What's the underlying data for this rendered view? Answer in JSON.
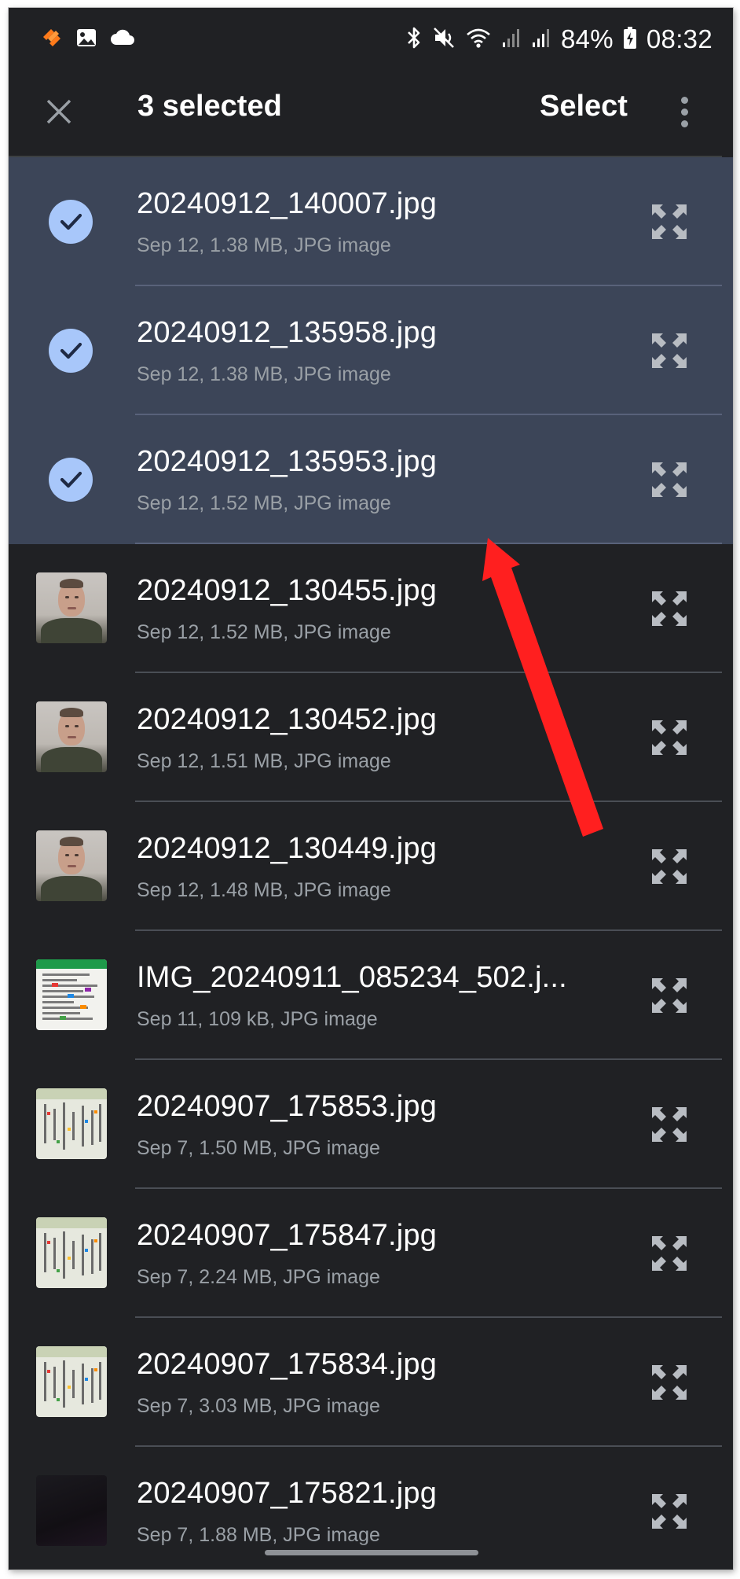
{
  "status_bar": {
    "battery": "84%",
    "time": "08:32",
    "left_icons": [
      "app-logo-icon",
      "gallery-icon",
      "cloud-icon"
    ],
    "right_icons": [
      "bluetooth-icon",
      "mute-icon",
      "wifi-icon",
      "signal-icon",
      "signal-icon",
      "battery-charging-icon"
    ]
  },
  "app_bar": {
    "title": "3 selected",
    "select_label": "Select",
    "close_icon": "close-icon",
    "more_icon": "more-vert-icon"
  },
  "colors": {
    "background": "#202124",
    "selected_row": "#3c4558",
    "check": "#a8c7fa",
    "meta_text": "#9aa0a6",
    "annotation_arrow": "#ff1f1f"
  },
  "files": [
    {
      "name": "20240912_140007.jpg",
      "meta": "Sep 12, 1.38 MB, JPG image",
      "selected": true,
      "thumb": "photo"
    },
    {
      "name": "20240912_135958.jpg",
      "meta": "Sep 12, 1.38 MB, JPG image",
      "selected": true,
      "thumb": "photo"
    },
    {
      "name": "20240912_135953.jpg",
      "meta": "Sep 12, 1.52 MB, JPG image",
      "selected": true,
      "thumb": "photo"
    },
    {
      "name": "20240912_130455.jpg",
      "meta": "Sep 12, 1.52 MB, JPG image",
      "selected": false,
      "thumb": "face"
    },
    {
      "name": "20240912_130452.jpg",
      "meta": "Sep 12, 1.51 MB, JPG image",
      "selected": false,
      "thumb": "face"
    },
    {
      "name": "20240912_130449.jpg",
      "meta": "Sep 12, 1.48 MB, JPG image",
      "selected": false,
      "thumb": "face"
    },
    {
      "name": "IMG_20240911_085234_502.j...",
      "meta": "Sep 11, 109 kB, JPG image",
      "selected": false,
      "thumb": "document"
    },
    {
      "name": "20240907_175853.jpg",
      "meta": "Sep 7, 1.50 MB, JPG image",
      "selected": false,
      "thumb": "sheet"
    },
    {
      "name": "20240907_175847.jpg",
      "meta": "Sep 7, 2.24 MB, JPG image",
      "selected": false,
      "thumb": "sheet"
    },
    {
      "name": "20240907_175834.jpg",
      "meta": "Sep 7, 3.03 MB, JPG image",
      "selected": false,
      "thumb": "sheet"
    },
    {
      "name": "20240907_175821.jpg",
      "meta": "Sep 7, 1.88 MB, JPG image",
      "selected": false,
      "thumb": "dark"
    }
  ],
  "row_icons": {
    "check": "check-circle-icon",
    "expand": "expand-icon"
  }
}
